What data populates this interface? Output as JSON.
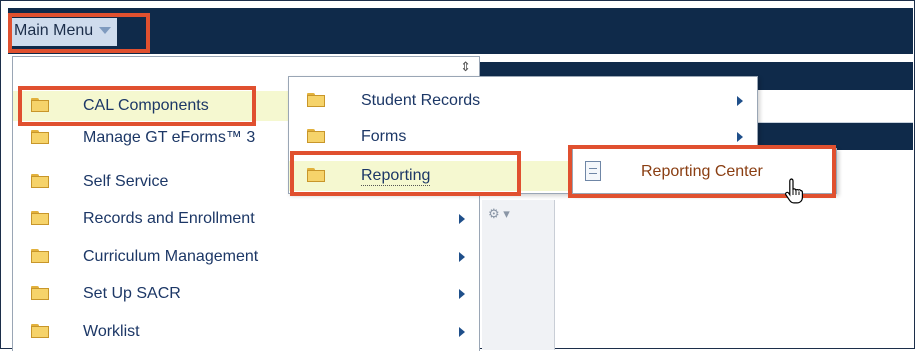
{
  "header": {
    "main_menu_label": "Main Menu"
  },
  "menu_level1": {
    "items": [
      {
        "label": "CAL Components",
        "has_submenu": true,
        "active": true
      },
      {
        "label": "Manage GT eForms™ 3",
        "has_submenu": false
      },
      {
        "label": "Self Service",
        "has_submenu": false
      },
      {
        "label": "Records and Enrollment",
        "has_submenu": true
      },
      {
        "label": "Curriculum Management",
        "has_submenu": true
      },
      {
        "label": "Set Up SACR",
        "has_submenu": true
      },
      {
        "label": "Worklist",
        "has_submenu": true
      }
    ]
  },
  "menu_level2": {
    "items": [
      {
        "label": "Student Records",
        "has_submenu": true
      },
      {
        "label": "Forms",
        "has_submenu": true
      },
      {
        "label": "Reporting",
        "has_submenu": false,
        "active": true
      }
    ]
  },
  "menu_level3": {
    "items": [
      {
        "label": "Reporting Center"
      }
    ]
  },
  "colors": {
    "navy": "#0f2a4a",
    "highlight_border": "#e0502f",
    "active_row": "#f5f8d0",
    "link_text": "#1c3766"
  },
  "icons": [
    "folder-icon",
    "document-icon",
    "scroll-arrows-icon",
    "gear-icon",
    "hand-cursor-icon"
  ]
}
